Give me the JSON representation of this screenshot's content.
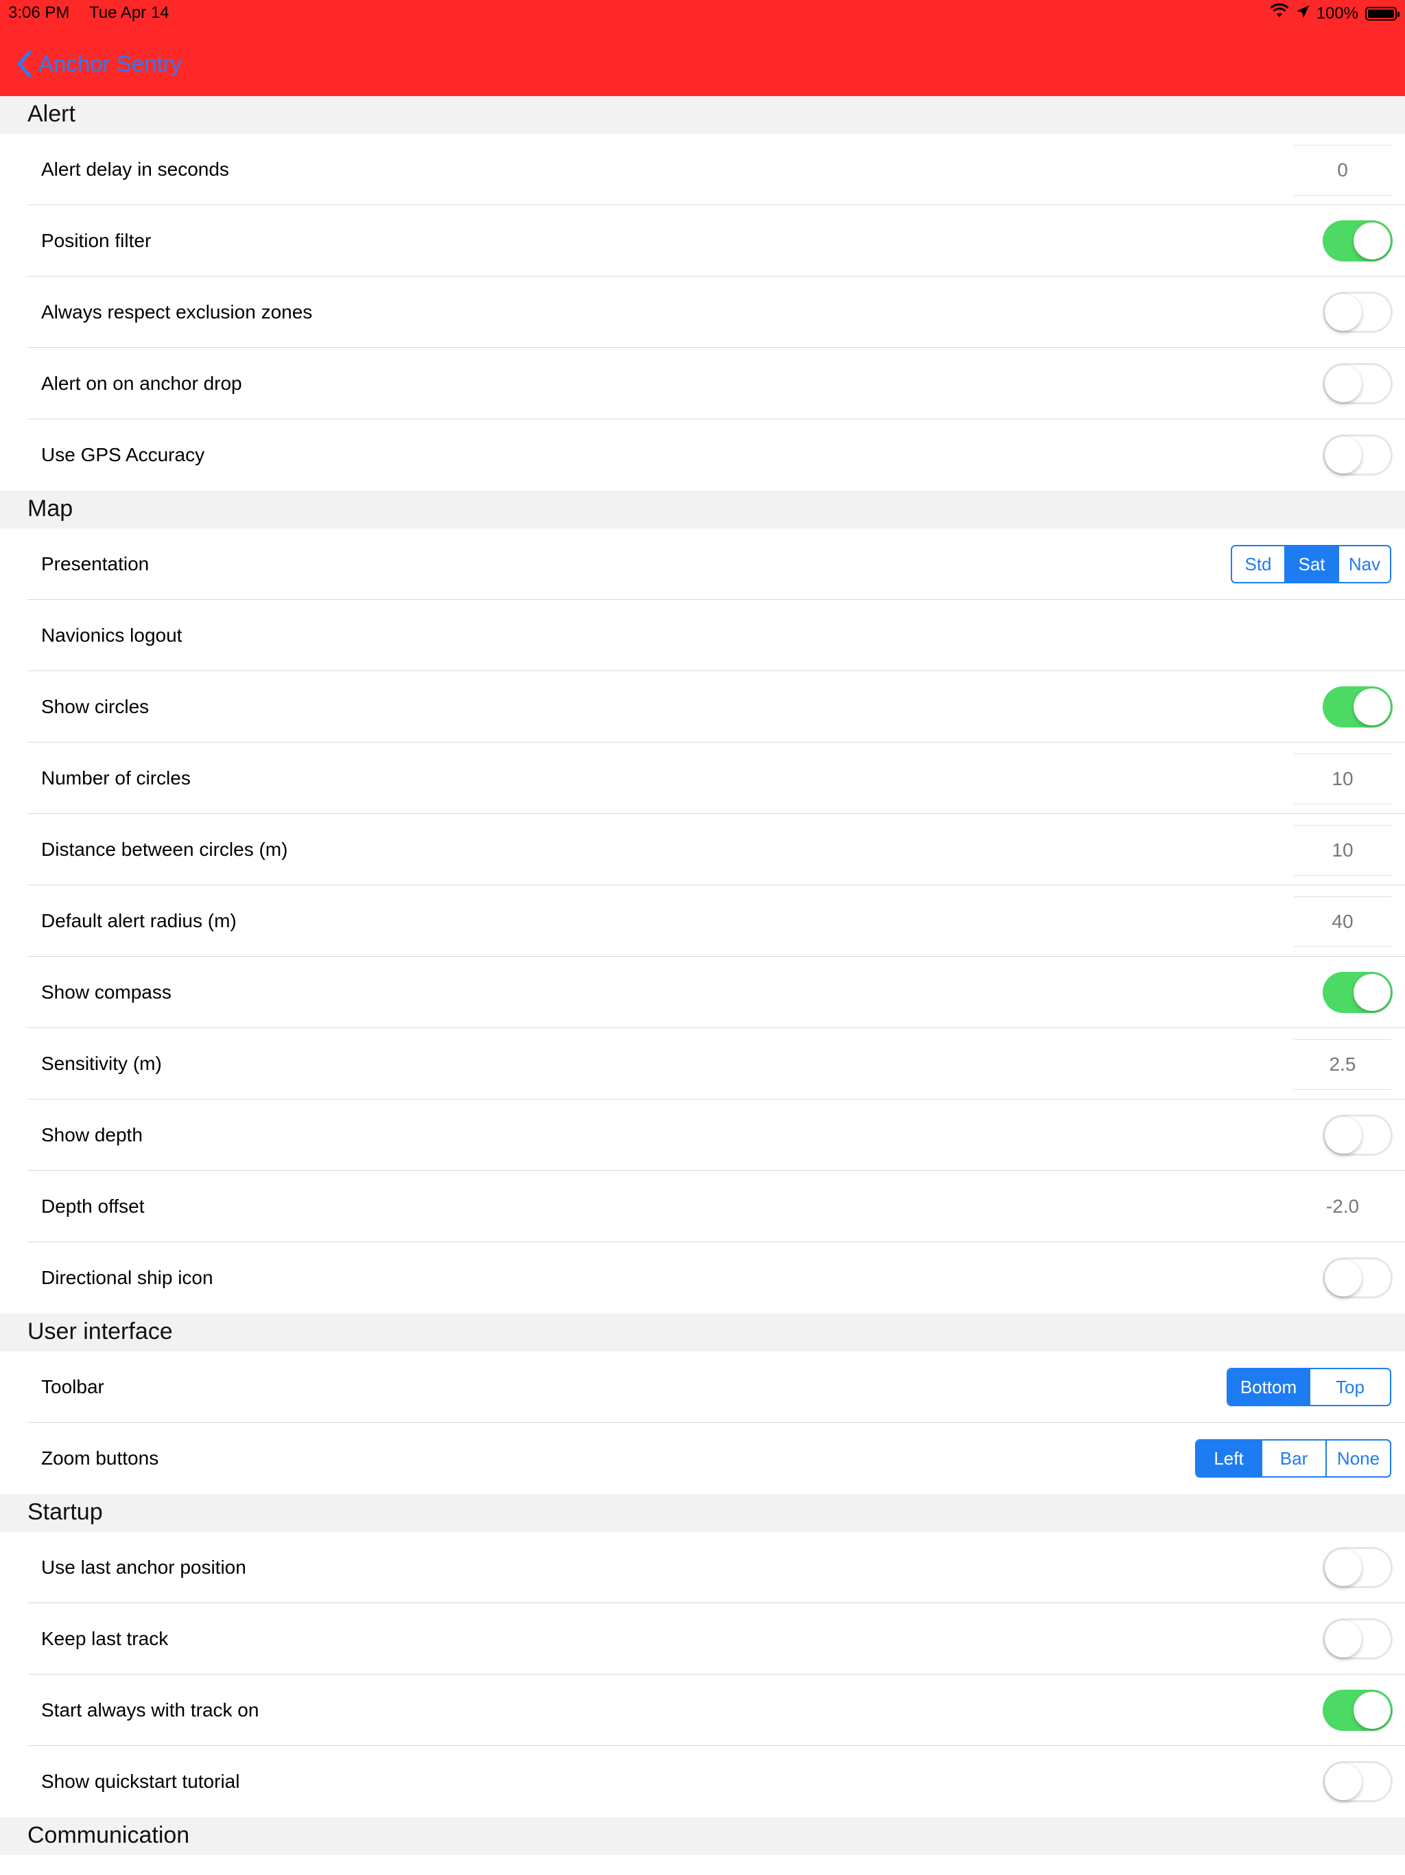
{
  "status_bar": {
    "time": "3:06 PM",
    "date": "Tue Apr 14",
    "battery": "100%"
  },
  "nav": {
    "back_label": "Anchor Sentry"
  },
  "colors": {
    "navbar": "#ff2828",
    "toggle_on": "#4cd964",
    "accent": "#1e7cf2"
  },
  "sections": {
    "alert": {
      "title": "Alert",
      "rows": [
        {
          "label": "Alert delay in seconds",
          "value": "0"
        },
        {
          "label": "Position filter",
          "on": true
        },
        {
          "label": "Always respect exclusion zones",
          "on": false
        },
        {
          "label": "Alert on on anchor drop",
          "on": false
        },
        {
          "label": "Use GPS Accuracy",
          "on": false
        }
      ]
    },
    "map": {
      "title": "Map",
      "rows": [
        {
          "label": "Presentation",
          "options": [
            "Std",
            "Sat",
            "Nav"
          ],
          "selected": "Sat"
        },
        {
          "label": "Navionics logout"
        },
        {
          "label": "Show circles",
          "on": true
        },
        {
          "label": "Number of circles",
          "value": "10"
        },
        {
          "label": "Distance between circles (m)",
          "value": "10"
        },
        {
          "label": "Default alert radius (m)",
          "value": "40"
        },
        {
          "label": "Show compass",
          "on": true
        },
        {
          "label": "Sensitivity (m)",
          "value": "2.5"
        },
        {
          "label": "Show depth",
          "on": false
        },
        {
          "label": "Depth offset",
          "value": "-2.0"
        },
        {
          "label": "Directional ship icon",
          "on": false
        }
      ]
    },
    "ui": {
      "title": "User interface",
      "rows": [
        {
          "label": "Toolbar",
          "options": [
            "Bottom",
            "Top"
          ],
          "selected": "Bottom"
        },
        {
          "label": "Zoom buttons",
          "options": [
            "Left",
            "Bar",
            "None"
          ],
          "selected": "Left"
        }
      ]
    },
    "startup": {
      "title": "Startup",
      "rows": [
        {
          "label": "Use last anchor position",
          "on": false
        },
        {
          "label": "Keep last track",
          "on": false
        },
        {
          "label": "Start always with track on",
          "on": true
        },
        {
          "label": "Show quickstart tutorial",
          "on": false
        }
      ]
    },
    "communication": {
      "title": "Communication"
    }
  }
}
